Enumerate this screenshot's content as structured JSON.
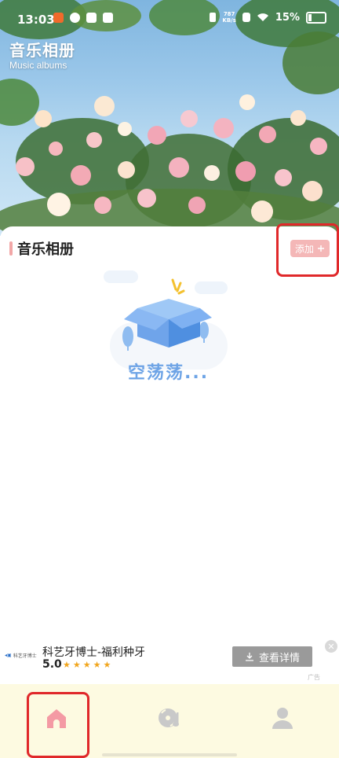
{
  "status_bar": {
    "time": "13:03",
    "net_speed": "787",
    "net_unit": "KB/s",
    "battery": "15%"
  },
  "header": {
    "title": "音乐相册",
    "subtitle": "Music albums"
  },
  "section": {
    "title": "音乐相册",
    "add_label": "添加",
    "add_icon": "plus-icon"
  },
  "empty_state": {
    "text": "空荡荡..."
  },
  "ad": {
    "logo_text": "科艺牙博士",
    "title": "科艺牙博士-福利种牙",
    "rating": "5.0",
    "stars": "★★★★★",
    "cta_label": "查看详情",
    "tag": "广告"
  },
  "nav": {
    "items": [
      {
        "name": "home",
        "icon": "home-icon",
        "active": true
      },
      {
        "name": "music",
        "icon": "music-disc-icon",
        "active": false
      },
      {
        "name": "profile",
        "icon": "user-icon",
        "active": false
      }
    ]
  },
  "colors": {
    "accent": "#f2a7a7",
    "highlight": "#e0282a",
    "nav_bg": "#fdfae1",
    "empty_text": "#6ea4e6"
  }
}
